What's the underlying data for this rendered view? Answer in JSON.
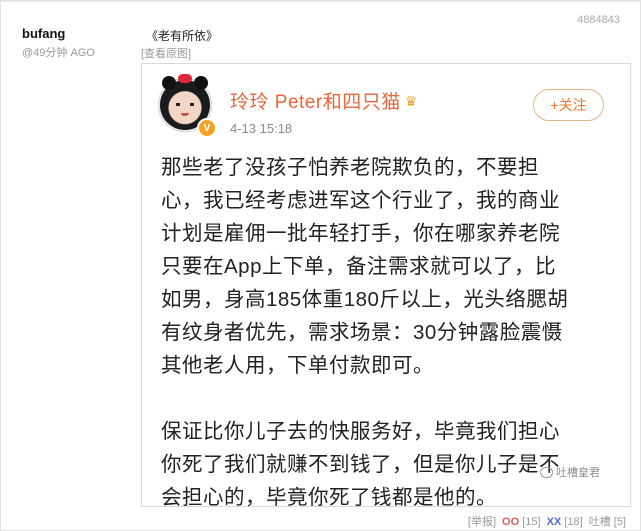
{
  "post": {
    "author": "bufang",
    "time": "@49分钟 AGO",
    "title": "《老有所依》",
    "view_original": "[查看原图]",
    "id": "4884843"
  },
  "screenshot": {
    "username": "玲玲 Peter和四只猫",
    "verified_badge": "V",
    "date": "4-13 15:18",
    "follow_label": "+关注",
    "lines": [
      "那些老了没孩子怕养老院欺负的，不要担",
      "心，我已经考虑进军这个行业了，我的商业",
      "计划是雇佣一批年轻打手，你在哪家养老院",
      "只要在App上下单，备注需求就可以了，比",
      "如男，身高185体重180斤以上，光头络腮胡",
      "有纹身者优先，需求场景：30分钟露脸震慑",
      "其他老人用，下单付款即可。",
      "",
      "保证比你儿子去的快服务好，毕竟我们担心",
      "你死了我们就赚不到钱了，但是你儿子是不",
      "会担心的，毕竟你死了钱都是他的。"
    ],
    "watermark": "吐槽皇君"
  },
  "footer": {
    "report": "[举报]",
    "oo_label": "OO",
    "oo_count": "[15]",
    "xx_label": "XX",
    "xx_count": "[18]",
    "tucao": "吐槽 [5]"
  },
  "colors": {
    "username": "#e8663a",
    "follow": "#e87a2a",
    "oo": "#e05a5a",
    "xx": "#4a6ee0"
  }
}
